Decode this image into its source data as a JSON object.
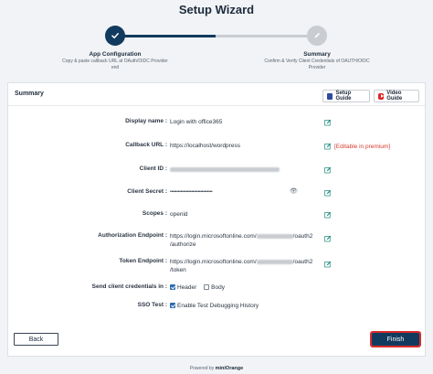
{
  "page_title": "Setup Wizard",
  "steps": [
    {
      "title": "App Configuration",
      "desc_line1": "Copy & paste callback URL at OAuth/OIDC Provider",
      "desc_line2": "end",
      "state": "done"
    },
    {
      "title": "Summary",
      "desc_line1": "Confirm & Verify Client Credentials of OAUTH/OIDC",
      "desc_line2": "Provider",
      "state": "todo"
    }
  ],
  "card": {
    "title": "Summary",
    "setup_guide_label": "Setup Guide",
    "video_guide_label": "Video Guide"
  },
  "fields": {
    "display_name": {
      "label": "Display name :",
      "value": "Login with office365"
    },
    "callback_url": {
      "label": "Callback URL :",
      "value": "https://localhost/wordpress",
      "note": "[Editable in premium]"
    },
    "client_id": {
      "label": "Client ID :"
    },
    "client_secret": {
      "label": "Client Secret :",
      "value": "••••••••••••••••••••••••••••••••"
    },
    "scopes": {
      "label": "Scopes :",
      "value": "openid"
    },
    "authorization_endpoint": {
      "label": "Authorization Endpoint :",
      "value_prefix": "https://login.microsoftonline.com/",
      "value_suffix": "/oauth2",
      "value_line2": "/authorize"
    },
    "token_endpoint": {
      "label": "Token Endpoint :",
      "value_prefix": "https://login.microsoftonline.com/",
      "value_suffix": "/oauth2",
      "value_line2": "/token"
    },
    "send_credentials": {
      "label": "Send client credentials in :",
      "option_header": "Header",
      "option_body": "Body",
      "header_checked": true,
      "body_checked": false
    },
    "sso_test": {
      "label": "SSO Test :",
      "option": "Enable Test Debugging History",
      "checked": true
    }
  },
  "buttons": {
    "back": "Back",
    "finish": "Finish"
  },
  "footer": {
    "powered_by": "Powered by",
    "brand": "miniOrange"
  },
  "colors": {
    "primary": "#123a5e",
    "premium_note": "#d63a2e",
    "finish_outline": "#d92b2b",
    "edit_icon": "#1a8a7a"
  }
}
